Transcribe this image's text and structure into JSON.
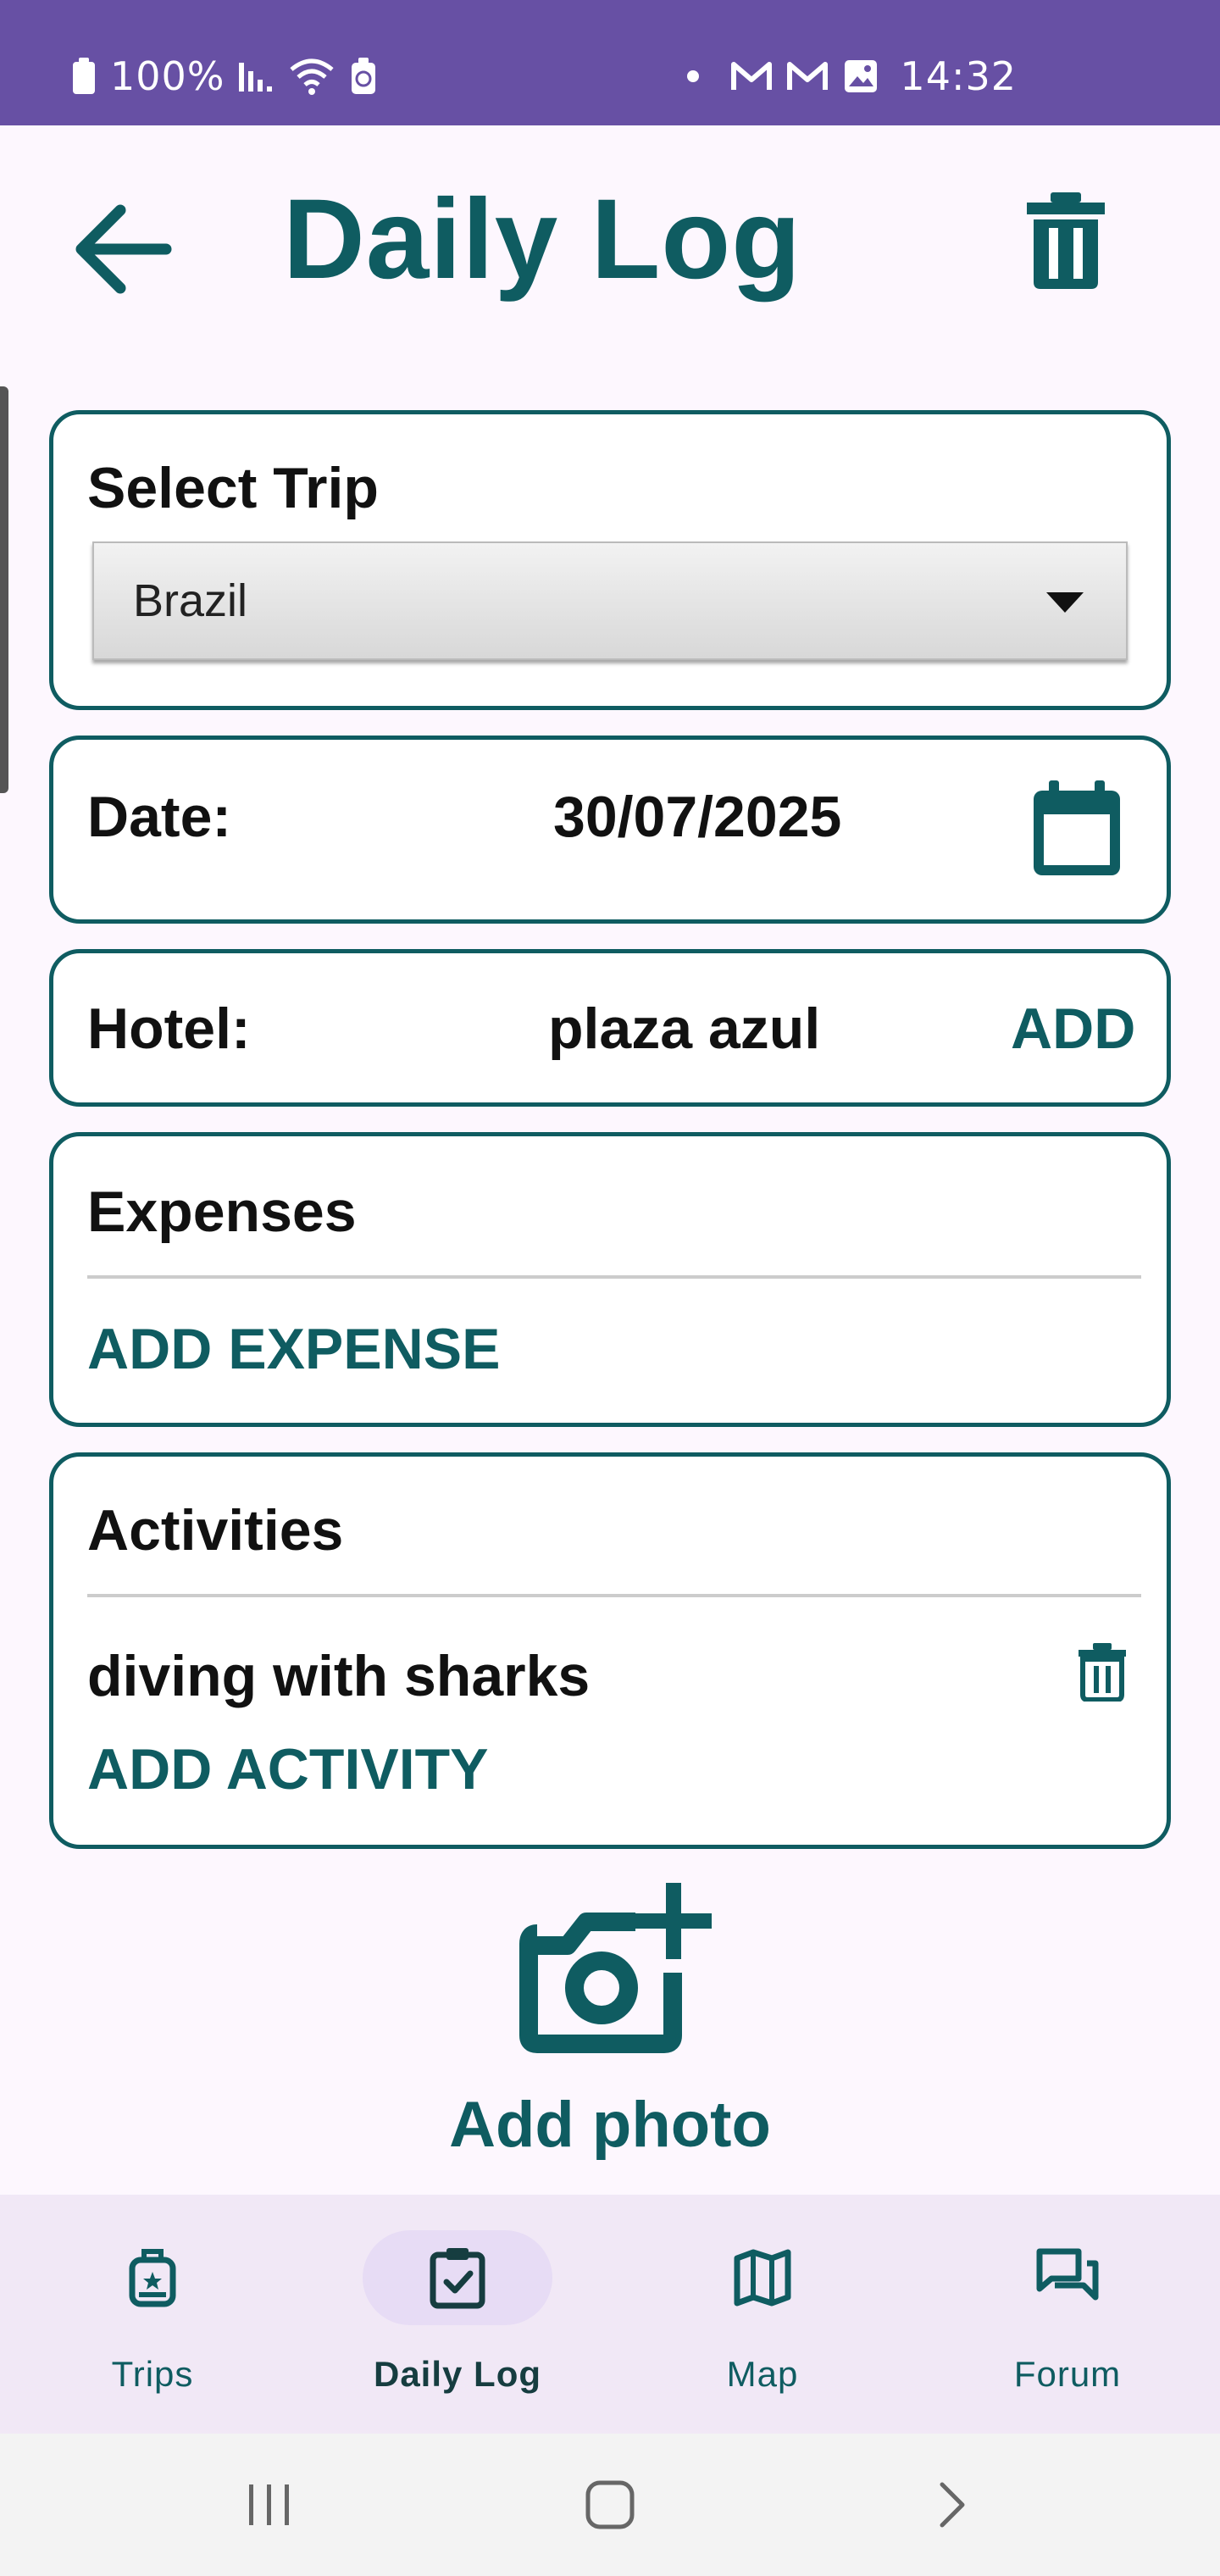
{
  "status_bar": {
    "battery": "100%",
    "time": "14:32",
    "icons": [
      "battery-icon",
      "signal-icon",
      "wifi-icon",
      "battery-saver-icon",
      "dot-icon",
      "gmail-icon",
      "gmail-icon",
      "image-icon"
    ]
  },
  "header": {
    "title": "Daily Log",
    "back_icon": "arrow-left-icon",
    "delete_icon": "trash-icon"
  },
  "trip": {
    "label": "Select Trip",
    "selected": "Brazil"
  },
  "date": {
    "label": "Date:",
    "value": "30/07/2025",
    "icon": "calendar-icon"
  },
  "hotel": {
    "label": "Hotel:",
    "value": "plaza azul",
    "action": "ADD"
  },
  "expenses": {
    "title": "Expenses",
    "add_label": "ADD EXPENSE",
    "items": []
  },
  "activities": {
    "title": "Activities",
    "items": [
      {
        "name": "diving with sharks"
      }
    ],
    "add_label": "ADD ACTIVITY"
  },
  "photo": {
    "label": "Add photo",
    "icon": "add-camera-icon"
  },
  "bottom_nav": {
    "items": [
      {
        "label": "Trips",
        "icon": "luggage-icon",
        "active": false
      },
      {
        "label": "Daily Log",
        "icon": "clipboard-check-icon",
        "active": true
      },
      {
        "label": "Map",
        "icon": "map-icon",
        "active": false
      },
      {
        "label": "Forum",
        "icon": "forum-icon",
        "active": false
      }
    ]
  },
  "colors": {
    "accent": "#0f5c61",
    "status_bar": "#6750a4",
    "background": "#fdf7fe",
    "nav_background": "#f1e8f6",
    "nav_active_pill": "#e7dcf5"
  }
}
